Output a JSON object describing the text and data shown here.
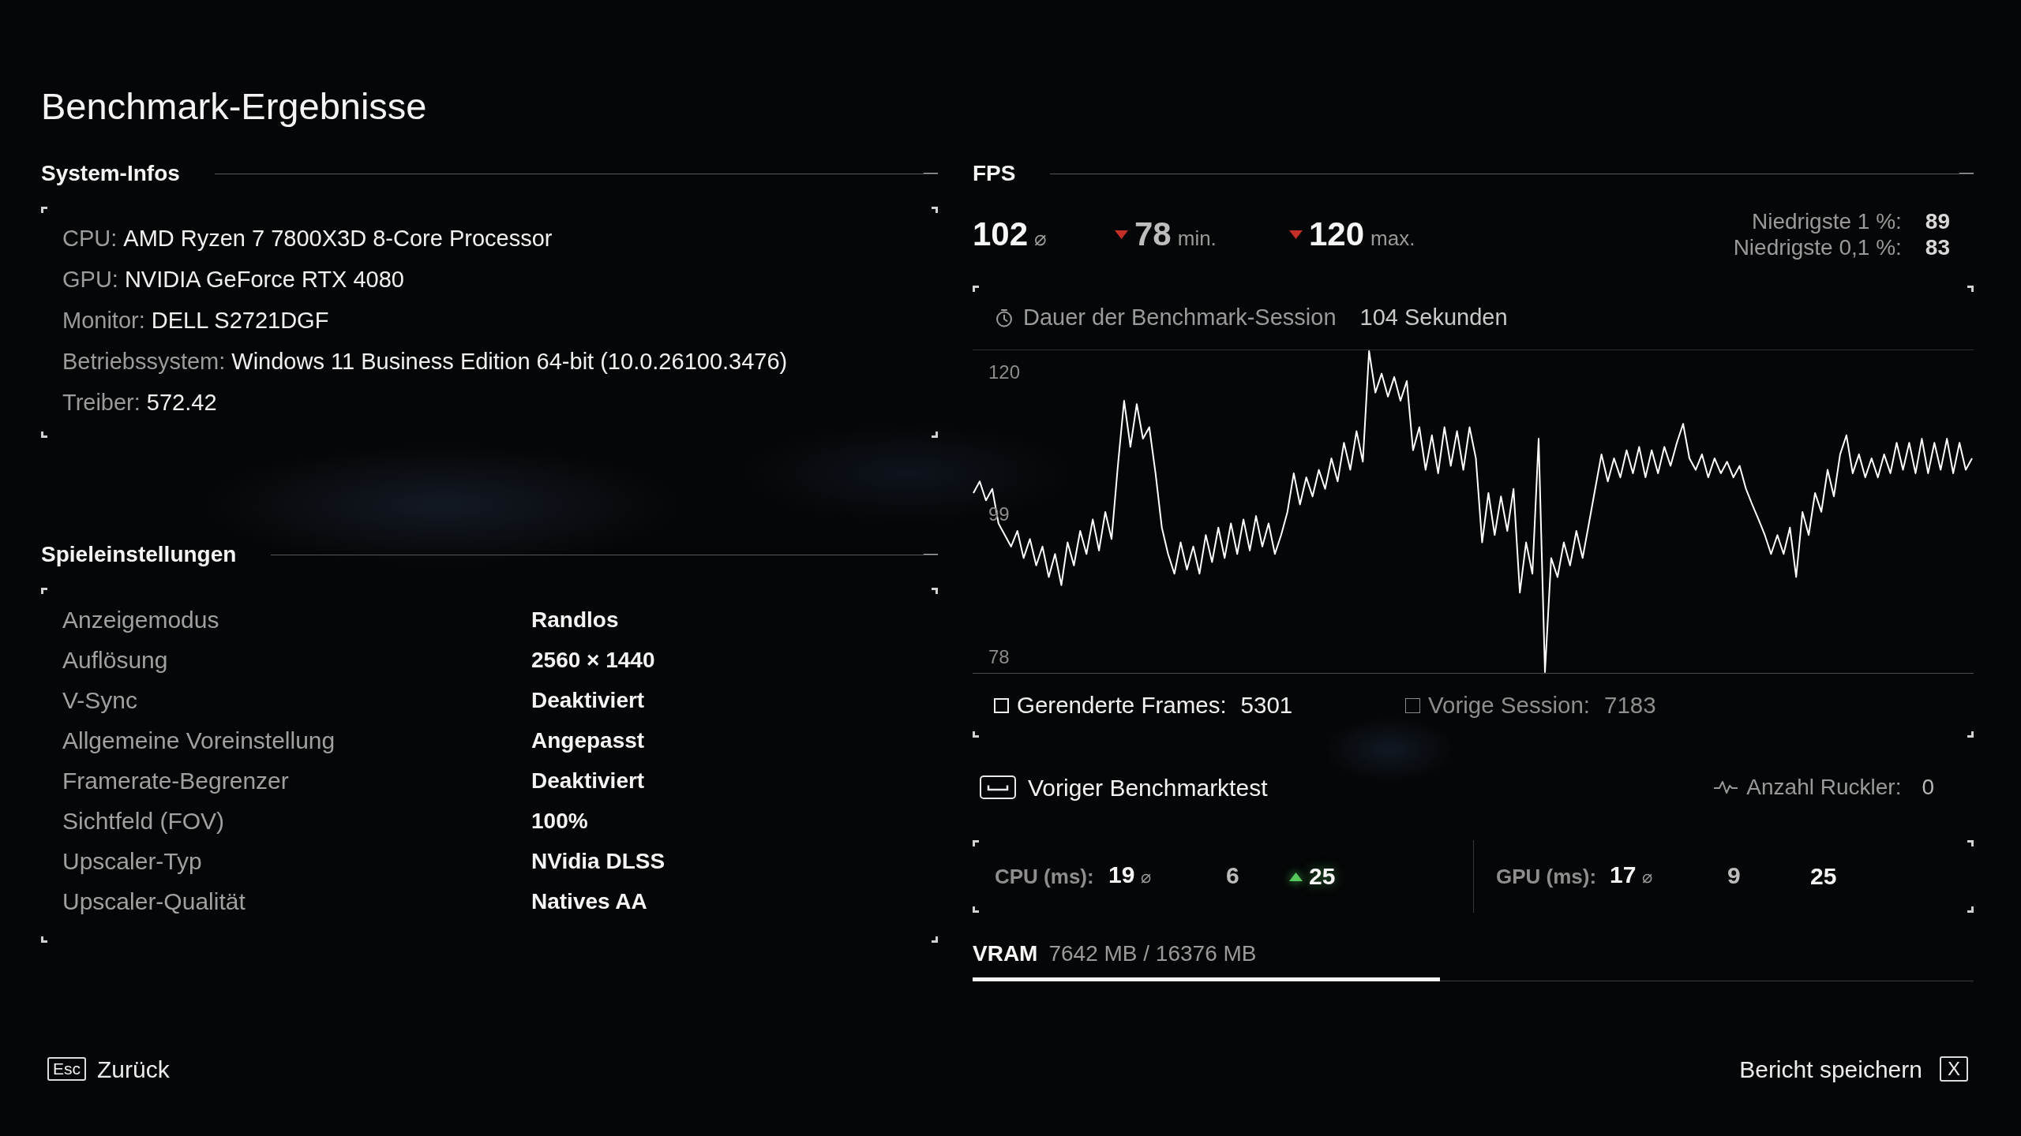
{
  "title": "Benchmark-Ergebnisse",
  "system_info": {
    "heading": "System-Infos",
    "items": [
      {
        "label": "CPU:",
        "value": "AMD Ryzen 7 7800X3D 8-Core Processor"
      },
      {
        "label": "GPU:",
        "value": "NVIDIA GeForce RTX 4080"
      },
      {
        "label": "Monitor:",
        "value": "DELL S2721DGF"
      },
      {
        "label": "Betriebssystem:",
        "value": "Windows 11 Business Edition 64-bit (10.0.26100.3476)"
      },
      {
        "label": "Treiber:",
        "value": "572.42"
      }
    ]
  },
  "game_settings": {
    "heading": "Spieleinstellungen",
    "items": [
      {
        "label": "Anzeigemodus",
        "value": "Randlos"
      },
      {
        "label": "Auflösung",
        "value": "2560 × 1440"
      },
      {
        "label": "V-Sync",
        "value": "Deaktiviert"
      },
      {
        "label": "Allgemeine Voreinstellung",
        "value": "Angepasst"
      },
      {
        "label": "Framerate-Begrenzer",
        "value": "Deaktiviert"
      },
      {
        "label": "Sichtfeld (FOV)",
        "value": "100%"
      },
      {
        "label": "Upscaler-Typ",
        "value": "NVidia DLSS"
      },
      {
        "label": "Upscaler-Qualität",
        "value": "Natives AA"
      }
    ]
  },
  "fps": {
    "heading": "FPS",
    "stats": [
      {
        "kind": "avg",
        "value": "102",
        "unit": "⌀",
        "trend_down": false
      },
      {
        "kind": "min",
        "value": "78",
        "unit": "min.",
        "trend_down": true
      },
      {
        "kind": "max",
        "value": "120",
        "unit": "max.",
        "trend_down": true
      }
    ],
    "lows": [
      {
        "label": "Niedrigste 1 %:",
        "value": "89"
      },
      {
        "label": "Niedrigste 0,1 %:",
        "value": "83"
      }
    ],
    "session": {
      "label": "Dauer der Benchmark-Session",
      "value": "104 Sekunden"
    },
    "chart_data": {
      "type": "line",
      "categories": [
        null,
        null,
        null,
        null,
        null,
        null,
        null,
        null,
        null,
        null,
        null,
        null,
        null,
        null,
        null,
        null,
        null,
        null,
        null,
        null,
        null,
        null,
        null,
        null,
        null,
        null,
        null,
        null,
        null,
        null,
        null,
        null,
        null,
        null,
        null,
        null,
        null,
        null,
        null,
        null,
        null,
        null,
        null,
        null,
        null,
        null,
        null,
        null,
        null,
        null,
        null,
        null,
        null,
        null,
        null,
        null,
        null,
        null,
        null,
        null,
        null,
        null,
        null,
        null,
        null,
        null,
        null,
        null,
        null,
        null,
        null,
        null,
        null,
        null,
        null,
        null,
        null,
        null,
        null,
        null,
        null,
        null,
        null,
        null,
        null,
        null,
        null,
        null,
        null,
        null,
        null,
        null,
        null,
        null,
        null,
        null,
        null,
        null,
        null,
        null,
        null,
        null,
        null,
        null,
        null,
        null,
        null,
        null,
        null,
        null,
        null,
        null,
        null,
        null,
        null,
        null,
        null,
        null,
        null,
        null,
        null,
        null,
        null,
        null,
        null,
        null,
        null,
        null,
        null,
        null,
        null,
        null,
        null,
        null,
        null,
        null,
        null,
        null,
        null,
        null,
        null,
        null,
        null,
        null,
        null,
        null,
        null,
        null,
        null,
        null,
        null,
        null,
        null,
        null,
        null,
        null,
        null,
        null,
        null,
        null
      ],
      "ylim": [
        66.02,
        132.68
      ],
      "yticks": [
        120,
        99,
        78
      ],
      "series": [
        {
          "color": "#ffffff",
          "values": [
            102.1,
            103.8,
            101.0,
            102.7,
            97.6,
            95.9,
            94.2,
            96.5,
            92.5,
            95.3,
            91.4,
            94.2,
            89.7,
            93.1,
            88.5,
            94.8,
            91.4,
            96.5,
            93.1,
            98.2,
            93.6,
            99.3,
            95.3,
            106.1,
            115.7,
            108.9,
            115.2,
            110.1,
            111.8,
            105.0,
            97.0,
            93.1,
            90.2,
            94.8,
            90.8,
            94.2,
            90.2,
            95.9,
            91.9,
            97.0,
            92.5,
            97.6,
            93.1,
            98.2,
            93.6,
            98.7,
            94.2,
            97.6,
            93.1,
            95.9,
            99.3,
            105.0,
            100.4,
            104.4,
            101.6,
            105.5,
            102.7,
            107.2,
            103.8,
            109.5,
            105.5,
            111.2,
            106.7,
            123.1,
            116.9,
            119.7,
            116.3,
            119.2,
            115.7,
            118.6,
            108.4,
            111.8,
            105.5,
            110.6,
            105.0,
            111.8,
            106.1,
            111.2,
            105.5,
            111.8,
            107.2,
            94.8,
            102.1,
            95.9,
            101.6,
            96.5,
            102.7,
            87.4,
            94.8,
            90.2,
            110.1,
            75.5,
            92.5,
            89.7,
            94.8,
            91.4,
            96.5,
            92.5,
            97.6,
            102.7,
            107.8,
            103.8,
            107.2,
            104.4,
            108.4,
            105.0,
            108.9,
            104.4,
            108.4,
            105.0,
            108.9,
            106.1,
            109.5,
            112.3,
            107.2,
            105.5,
            107.8,
            104.4,
            107.2,
            105.0,
            106.7,
            104.4,
            106.1,
            102.7,
            100.4,
            98.2,
            95.9,
            93.1,
            95.9,
            93.1,
            97.0,
            89.7,
            99.3,
            95.9,
            102.1,
            99.3,
            105.5,
            101.6,
            107.8,
            110.6,
            105.0,
            107.8,
            104.4,
            107.2,
            104.4,
            107.8,
            105.0,
            109.5,
            105.5,
            109.5,
            105.0,
            110.1,
            105.0,
            109.5,
            105.5,
            110.1,
            105.0,
            109.5,
            105.5,
            107.2
          ]
        }
      ]
    },
    "legend": [
      {
        "label": "Gerenderte Frames:",
        "value": "5301",
        "active": true
      },
      {
        "label": "Vorige Session:",
        "value": "7183",
        "active": false
      }
    ]
  },
  "previous_benchmark": {
    "label": "Voriger Benchmarktest"
  },
  "stutter": {
    "label": "Anzahl Ruckler:",
    "value": "0"
  },
  "frame_times": [
    {
      "label": "CPU (ms):",
      "avg": "19",
      "avg_unit": "⌀",
      "min": "6",
      "max": "25",
      "max_trend_up": true
    },
    {
      "label": "GPU (ms):",
      "avg": "17",
      "avg_unit": "⌀",
      "min": "9",
      "max": "25",
      "max_trend_up": false
    }
  ],
  "vram": {
    "label": "VRAM",
    "value": "7642 MB / 16376 MB",
    "level": 0.467
  },
  "footer": {
    "back": {
      "key": "Esc",
      "label": "Zurück"
    },
    "save": {
      "label": "Bericht speichern",
      "key": "X"
    }
  }
}
